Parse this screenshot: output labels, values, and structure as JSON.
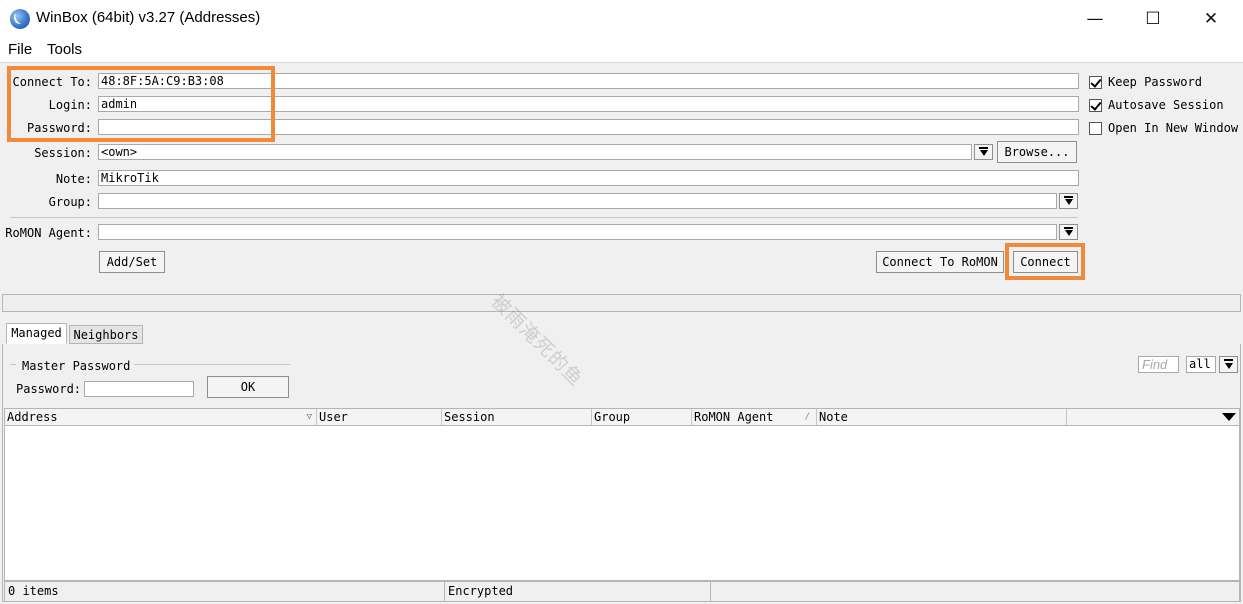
{
  "window": {
    "title": "WinBox (64bit) v3.27 (Addresses)",
    "controls": {
      "minimize": "—",
      "maximize": "☐",
      "close": "✕"
    }
  },
  "menu": {
    "items": [
      "File",
      "Tools"
    ]
  },
  "form": {
    "connect_to": {
      "label": "Connect To:",
      "value": "48:8F:5A:C9:B3:08"
    },
    "login": {
      "label": "Login:",
      "value": "admin"
    },
    "password": {
      "label": "Password:",
      "value": ""
    },
    "session": {
      "label": "Session:",
      "value": "<own>"
    },
    "browse_label": "Browse...",
    "note": {
      "label": "Note:",
      "value": "MikroTik"
    },
    "group": {
      "label": "Group:",
      "value": ""
    },
    "romon_agent": {
      "label": "RoMON Agent:",
      "value": ""
    },
    "add_set_label": "Add/Set",
    "connect_to_romon_label": "Connect To RoMON",
    "connect_label": "Connect"
  },
  "options": {
    "keep_password": {
      "label": "Keep Password",
      "checked": true
    },
    "autosave_session": {
      "label": "Autosave Session",
      "checked": true
    },
    "open_new_window": {
      "label": "Open In New Window",
      "checked": false
    }
  },
  "tabs": [
    {
      "label": "Managed",
      "active": true
    },
    {
      "label": "Neighbors",
      "active": false
    }
  ],
  "master_password": {
    "group_label": "Master Password",
    "password_label": "Password:",
    "password_value": "",
    "ok_label": "OK"
  },
  "filter": {
    "find_placeholder": "Find",
    "scope_value": "all"
  },
  "table": {
    "columns": [
      "Address",
      "User",
      "Session",
      "Group",
      "RoMON Agent",
      "Note"
    ],
    "rows": []
  },
  "status": {
    "items_count": "0 items",
    "encryption": "Encrypted"
  },
  "watermark": "被雨淹死的鱼",
  "colors": {
    "highlight": "#f0893a"
  }
}
